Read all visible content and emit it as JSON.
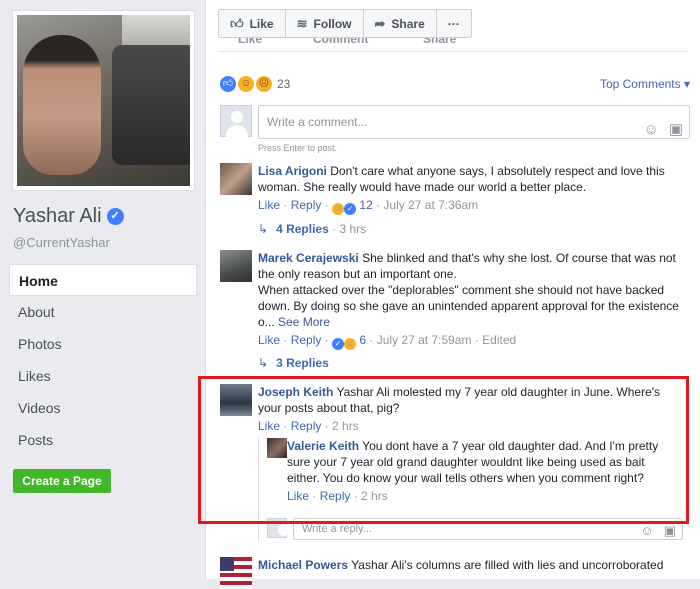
{
  "page": {
    "name": "Yashar Ali",
    "handle": "@CurrentYashar",
    "verified_mark": "✓"
  },
  "nav": {
    "items": [
      {
        "label": "Home"
      },
      {
        "label": "About"
      },
      {
        "label": "Photos"
      },
      {
        "label": "Likes"
      },
      {
        "label": "Videos"
      },
      {
        "label": "Posts"
      }
    ],
    "create_page": "Create a Page"
  },
  "toolbar": {
    "like": "Like",
    "follow": "Follow",
    "share": "Share",
    "more": "···"
  },
  "ghost_row": {
    "like": "Like",
    "comment": "Comment",
    "share": "Share"
  },
  "post": {
    "reaction_count": "23",
    "top_comments": "Top Comments ▾",
    "comment_placeholder": "Write a comment...",
    "press_enter": "Press Enter to post."
  },
  "comments": [
    {
      "name": "Lisa Arigoni",
      "text": "Don't care what anyone says, I absolutely respect and love this woman. She really would have made our world a better place.",
      "like": "Like",
      "reply": "Reply",
      "reactions": "12",
      "time": "July 27 at 7:36am",
      "replies": "4 Replies",
      "replies_time": "3 hrs"
    },
    {
      "name": "Marek Cerajewski",
      "text": "She blinked and that's why she lost. Of course that was not the only reason but an important one.",
      "text2": "When attacked over the \"deplorables\" comment she should not have backed down. By doing so she gave an unintended apparent approval for the existence o...",
      "see_more": "See More",
      "like": "Like",
      "reply": "Reply",
      "reactions": "6",
      "time": "July 27 at 7:59am",
      "edited": "Edited",
      "replies": "3 Replies"
    },
    {
      "name": "Joseph Keith",
      "text": "Yashar Ali molested my 7 year old daughter in June. Where's your posts about that, pig?",
      "like": "Like",
      "reply": "Reply",
      "time": "2 hrs"
    },
    {
      "name": "Michael Powers",
      "text": "Yashar Ali's columns are filled with lies and uncorroborated"
    }
  ],
  "reply_item": {
    "name": "Valerie Keith",
    "text": "You dont have a 7 year old daughter dad. And I'm pretty sure your 7 year old grand daughter wouldnt like being used as bait either. You do know your wall tells others when you comment right?",
    "like": "Like",
    "reply": "Reply",
    "time": "2 hrs",
    "reply_placeholder": "Write a reply..."
  },
  "colors": {
    "link": "#365899",
    "highlight": "#e0191f",
    "cta": "#42b72a"
  }
}
